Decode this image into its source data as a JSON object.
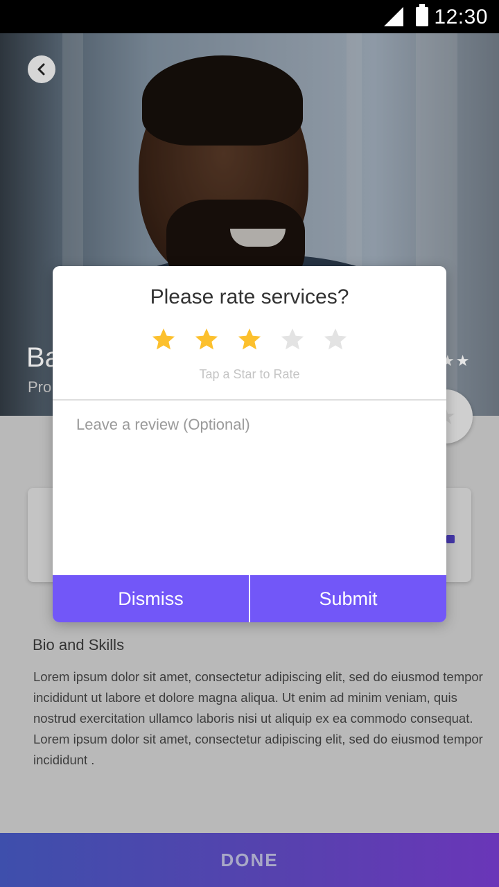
{
  "status_bar": {
    "time": "12:30",
    "icons": [
      "signal-icon",
      "battery-icon"
    ]
  },
  "hero": {
    "back_icon": "chevron-left-icon",
    "name_partial": "Ba",
    "subtitle_partial": "Pro",
    "favorite_icon": "star-icon"
  },
  "rating_modal": {
    "title": "Please rate services?",
    "rating": 3,
    "max_rating": 5,
    "star_filled_color": "#FCC02D",
    "star_empty_color": "#E3E3E3",
    "hint": "Tap a Star to Rate",
    "review_placeholder": "Leave a review (Optional)",
    "review_value": "",
    "dismiss_label": "Dismiss",
    "submit_label": "Submit",
    "button_color": "#7257F8"
  },
  "bio": {
    "title": "Bio and Skills",
    "text": "Lorem ipsum dolor sit amet, consectetur adipiscing elit, sed do eiusmod tempor incididunt ut labore et dolore magna aliqua. Ut enim ad minim veniam, quis nostrud exercitation ullamco laboris nisi ut aliquip ex ea commodo consequat. Lorem ipsum dolor sit amet, consectetur adipiscing elit, sed do eiusmod tempor incididunt ."
  },
  "footer": {
    "done_label": "DONE"
  }
}
